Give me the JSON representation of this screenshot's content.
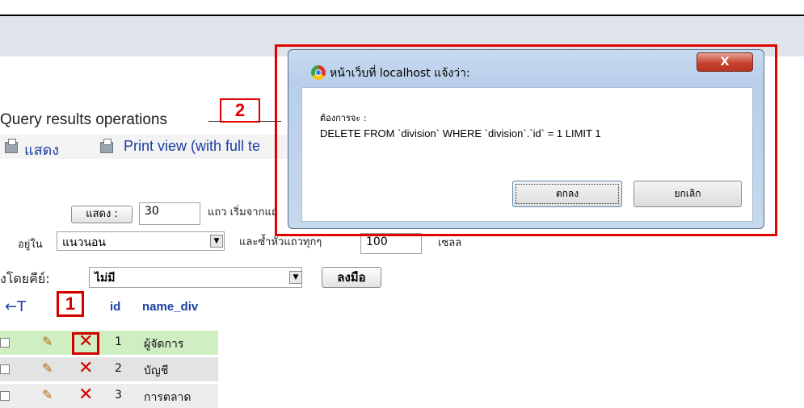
{
  "page": {
    "section_title": "Query results operations",
    "annotation_2": "2",
    "annotation_1": "1",
    "show_link": "แสดง",
    "print_view_link": "Print view (with full te"
  },
  "controls": {
    "show_button": "แสดง :",
    "rows_value": "30",
    "rows_label": "แถว เริ่มจากแถ",
    "mode_label": "อยู่ใน",
    "mode_value": "แนวนอน",
    "repeat_label": "และซ้ำหัวแถวทุกๆ",
    "repeat_value": "100",
    "cells_label": "เซลล",
    "sort_label": "งโดยคีย์:",
    "sort_value": "ไม่มี",
    "go_button": "ลงมือ"
  },
  "table": {
    "columns": [
      "id",
      "name_div"
    ],
    "rows": [
      {
        "id": "1",
        "name": "ผู้จัดการ"
      },
      {
        "id": "2",
        "name": "บัญชี"
      },
      {
        "id": "3",
        "name": "การตลาด"
      }
    ]
  },
  "dialog": {
    "title": "หน้าเว็บที่ localhost แจ้งว่า:",
    "close": "X",
    "message_line1": "ต้องการจะ :",
    "message_line2": "DELETE FROM `division` WHERE `division`.`id` = 1 LIMIT 1",
    "ok_button": "ตกลง",
    "cancel_button": "ยกเลิก"
  },
  "colors": {
    "accent_red": "#e00000",
    "link_blue": "#1a3ea6",
    "highlight_row": "#cfeec2"
  }
}
